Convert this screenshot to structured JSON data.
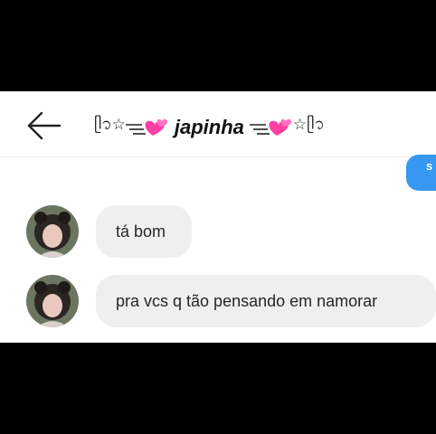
{
  "header": {
    "title_name": "japinha",
    "deco_left": "ᥫ᭡☆",
    "deco_right": "☆ᥫ᭡",
    "back_icon": "arrow-left-icon"
  },
  "sent_message": {
    "text": "s",
    "color": "#3897f0"
  },
  "messages": [
    {
      "text": "tá bom"
    },
    {
      "text": "pra vcs q tão pensando em namorar"
    }
  ],
  "colors": {
    "incoming_bubble": "#efefef",
    "outgoing_bubble": "#3897f0",
    "heart": "#ff3fa4"
  }
}
